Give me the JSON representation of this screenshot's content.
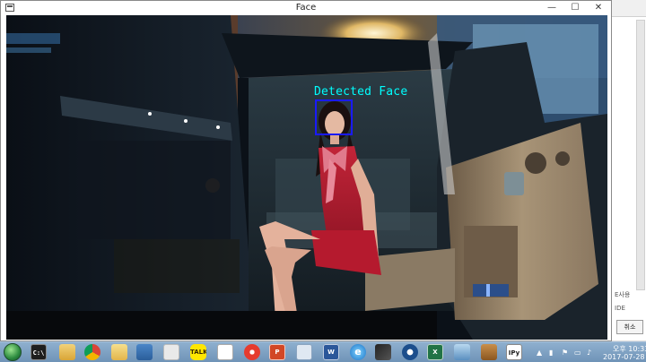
{
  "window": {
    "title": "Face",
    "minimize_glyph": "—",
    "maximize_glyph": "☐",
    "close_glyph": "✕"
  },
  "overlay": {
    "face_label": "Detected Face",
    "label_color": "#00ffff",
    "box_color": "#1a1aff"
  },
  "background_window": {
    "fragment_1": "E사용",
    "fragment_2": "IDE",
    "button_label": "취소"
  },
  "taskbar": {
    "apps": [
      {
        "name": "windows-start-icon"
      },
      {
        "name": "command-prompt-icon",
        "text": "C:\\"
      },
      {
        "name": "file-explorer-folder-icon"
      },
      {
        "name": "chrome-icon"
      },
      {
        "name": "folder-icon"
      },
      {
        "name": "tools-icon"
      },
      {
        "name": "kakaotalk-icon",
        "text": "TALK"
      },
      {
        "name": "calendar-icon"
      },
      {
        "name": "paint-icon"
      },
      {
        "name": "powerpoint-icon",
        "text": "P"
      },
      {
        "name": "document-icon"
      },
      {
        "name": "word-icon",
        "text": "W"
      },
      {
        "name": "internet-explorer-icon",
        "text": "e"
      },
      {
        "name": "winamp-icon"
      },
      {
        "name": "settings-gear-icon"
      },
      {
        "name": "excel-icon",
        "text": "X"
      },
      {
        "name": "media-player-icon"
      },
      {
        "name": "archive-icon"
      },
      {
        "name": "ipython-icon",
        "text": "IPy"
      }
    ],
    "clock": {
      "time": "오후 10:33",
      "date": "2017-07-28"
    }
  }
}
